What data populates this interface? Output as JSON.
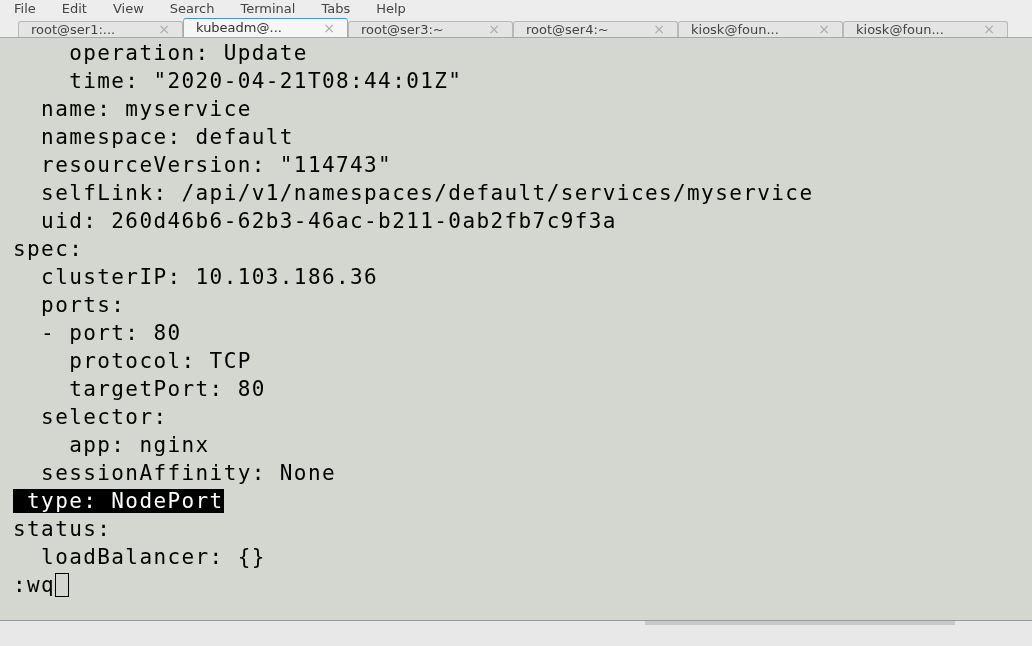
{
  "menu": [
    "File",
    "Edit",
    "View",
    "Search",
    "Terminal",
    "Tabs",
    "Help"
  ],
  "tabs": [
    {
      "label": "root@ser1:...",
      "close": "×",
      "selected": false
    },
    {
      "label": "kubeadm@...",
      "close": "×",
      "selected": true
    },
    {
      "label": "root@ser3:~",
      "close": "×",
      "selected": false
    },
    {
      "label": "root@ser4:~",
      "close": "×",
      "selected": false
    },
    {
      "label": "kiosk@foun...",
      "close": "×",
      "selected": false
    },
    {
      "label": "kiosk@foun...",
      "close": "×",
      "selected": false
    }
  ],
  "lines": [
    {
      "text": "    operation: Update",
      "highlighted": false
    },
    {
      "text": "    time: \"2020-04-21T08:44:01Z\"",
      "highlighted": false
    },
    {
      "text": "  name: myservice",
      "highlighted": false
    },
    {
      "text": "  namespace: default",
      "highlighted": false
    },
    {
      "text": "  resourceVersion: \"114743\"",
      "highlighted": false
    },
    {
      "text": "  selfLink: /api/v1/namespaces/default/services/myservice",
      "highlighted": false
    },
    {
      "text": "  uid: 260d46b6-62b3-46ac-b211-0ab2fb7c9f3a",
      "highlighted": false
    },
    {
      "text": "spec:",
      "highlighted": false
    },
    {
      "text": "  clusterIP: 10.103.186.36",
      "highlighted": false
    },
    {
      "text": "  ports:",
      "highlighted": false
    },
    {
      "text": "  - port: 80",
      "highlighted": false
    },
    {
      "text": "    protocol: TCP",
      "highlighted": false
    },
    {
      "text": "    targetPort: 80",
      "highlighted": false
    },
    {
      "text": "  selector:",
      "highlighted": false
    },
    {
      "text": "    app: nginx",
      "highlighted": false
    },
    {
      "text": "  sessionAffinity: None",
      "highlighted": false
    },
    {
      "text": " type: NodePort",
      "highlighted": true
    },
    {
      "text": "status:",
      "highlighted": false
    },
    {
      "text": "  loadBalancer: {}",
      "highlighted": false
    }
  ],
  "command": ":wq"
}
